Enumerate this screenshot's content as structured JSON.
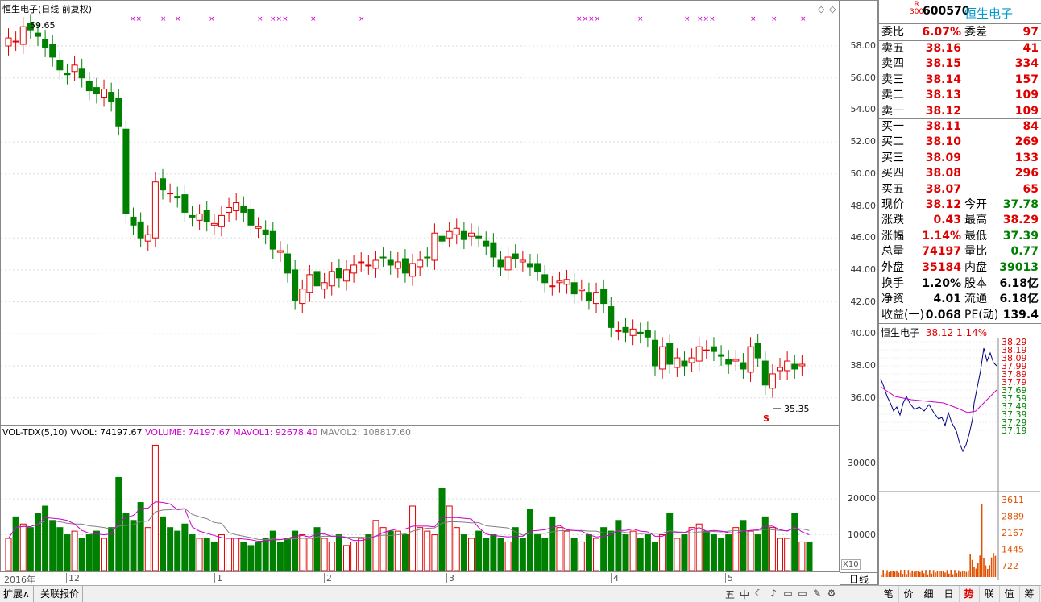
{
  "main": {
    "title": "恒生电子(日线 前复权)",
    "high_label": "59.65",
    "low_label": "35.35",
    "marker": "S",
    "price_ticks": [
      "58.00",
      "56.00",
      "54.00",
      "52.00",
      "50.00",
      "48.00",
      "46.00",
      "44.00",
      "42.00",
      "40.00",
      "38.00",
      "36.00"
    ]
  },
  "volume": {
    "title": "VOL-TDX(5,10)",
    "vvol": "VVOL: 74197.67",
    "volume_label": "VOLUME: 74197.67",
    "mavol1": "MAVOL1: 92678.40",
    "mavol2": "MAVOL2: 108817.60",
    "ticks": [
      "30000",
      "20000",
      "10000"
    ],
    "unit": "X10"
  },
  "dates": [
    "2016年",
    "12",
    "1",
    "2",
    "3",
    "4",
    "5"
  ],
  "day_line_label": "日线",
  "bottom_tabs": [
    "扩展∧",
    "关联报价"
  ],
  "tool_icons": [
    "五",
    "中",
    "☾",
    "♪",
    "▭",
    "▭",
    "✎",
    "⚙"
  ],
  "quote": {
    "code": "600570",
    "name": "恒生电子",
    "badge": "R",
    "badge_sub": "300",
    "weibi_label": "委比",
    "weibi": "6.07%",
    "weicha_label": "委差",
    "weicha": "97",
    "asks": [
      {
        "label": "卖五",
        "price": "38.16",
        "vol": "41"
      },
      {
        "label": "卖四",
        "price": "38.15",
        "vol": "334"
      },
      {
        "label": "卖三",
        "price": "38.14",
        "vol": "157"
      },
      {
        "label": "卖二",
        "price": "38.13",
        "vol": "109"
      },
      {
        "label": "卖一",
        "price": "38.12",
        "vol": "109"
      }
    ],
    "bids": [
      {
        "label": "买一",
        "price": "38.11",
        "vol": "84"
      },
      {
        "label": "买二",
        "price": "38.10",
        "vol": "269"
      },
      {
        "label": "买三",
        "price": "38.09",
        "vol": "133"
      },
      {
        "label": "买四",
        "price": "38.08",
        "vol": "296"
      },
      {
        "label": "买五",
        "price": "38.07",
        "vol": "65"
      }
    ],
    "stats": [
      {
        "l1": "现价",
        "v1": "38.12",
        "c1": "red",
        "l2": "今开",
        "v2": "37.78",
        "c2": "green"
      },
      {
        "l1": "涨跌",
        "v1": "0.43",
        "c1": "red",
        "l2": "最高",
        "v2": "38.29",
        "c2": "red"
      },
      {
        "l1": "涨幅",
        "v1": "1.14%",
        "c1": "red",
        "l2": "最低",
        "v2": "37.39",
        "c2": "green"
      },
      {
        "l1": "总量",
        "v1": "74197",
        "c1": "red",
        "l2": "量比",
        "v2": "0.77",
        "c2": "green"
      },
      {
        "l1": "外盘",
        "v1": "35184",
        "c1": "red",
        "l2": "内盘",
        "v2": "39013",
        "c2": "green"
      }
    ],
    "fund": [
      {
        "l1": "换手",
        "v1": "1.20%",
        "l2": "股本",
        "v2": "6.18亿"
      },
      {
        "l1": "净资",
        "v1": "4.01",
        "l2": "流通",
        "v2": "6.18亿"
      },
      {
        "l1": "收益(一)",
        "v1": "0.068",
        "l2": "PE(动)",
        "v2": "139.4"
      }
    ]
  },
  "intraday": {
    "name": "恒生电子",
    "price": "38.12",
    "pct": "1.14%",
    "ticks": [
      "38.29",
      "38.19",
      "38.09",
      "37.99",
      "37.89",
      "37.79",
      "37.69",
      "37.59",
      "37.49",
      "37.39",
      "37.29",
      "37.19"
    ],
    "vol_ticks": [
      "3611",
      "2889",
      "2167",
      "1445",
      "722"
    ]
  },
  "right_tabs": [
    "笔",
    "价",
    "细",
    "日",
    "势",
    "联",
    "值",
    "筹"
  ],
  "colors": {
    "up": "#e00000",
    "down": "#008000",
    "ma1": "#cc00cc",
    "ma2": "#808080"
  }
}
